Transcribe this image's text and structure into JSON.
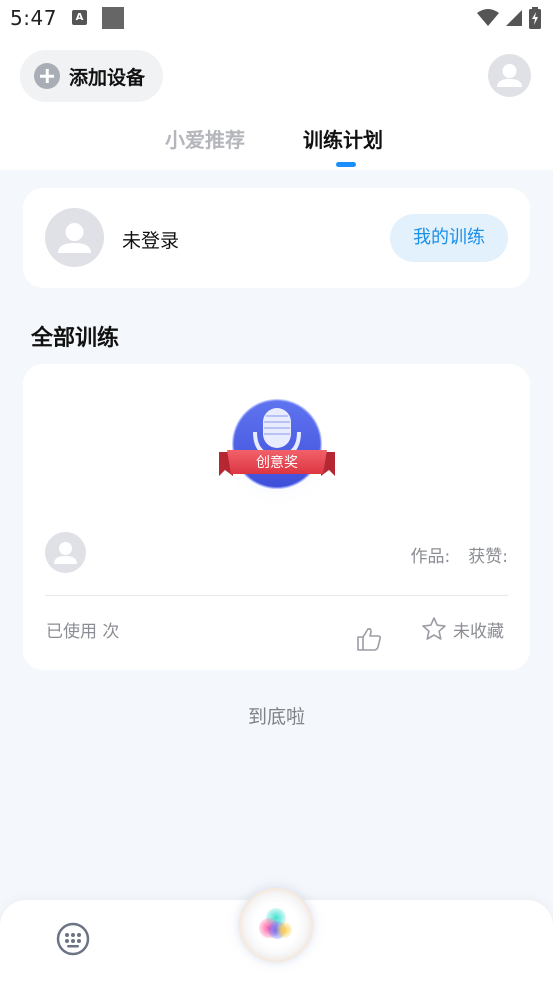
{
  "status": {
    "time": "5:47",
    "a_icon": "A"
  },
  "header": {
    "add_device_label": "添加设备"
  },
  "tabs": [
    {
      "label": "小爱推荐",
      "active": false
    },
    {
      "label": "训练计划",
      "active": true
    }
  ],
  "login_card": {
    "status_text": "未登录",
    "button_label": "我的训练"
  },
  "section": {
    "title": "全部训练"
  },
  "training_item": {
    "badge_text": "创意奖",
    "works_label": "作品:",
    "likes_label": "获赞:",
    "used_text": "已使用 次",
    "favorite_text": "未收藏"
  },
  "footer": {
    "end_text": "到底啦"
  },
  "colors": {
    "accent": "#1a8fff",
    "button_bg": "#e3f1fd",
    "badge_blue": "#4a5de8",
    "ribbon_red": "#e8434f"
  }
}
